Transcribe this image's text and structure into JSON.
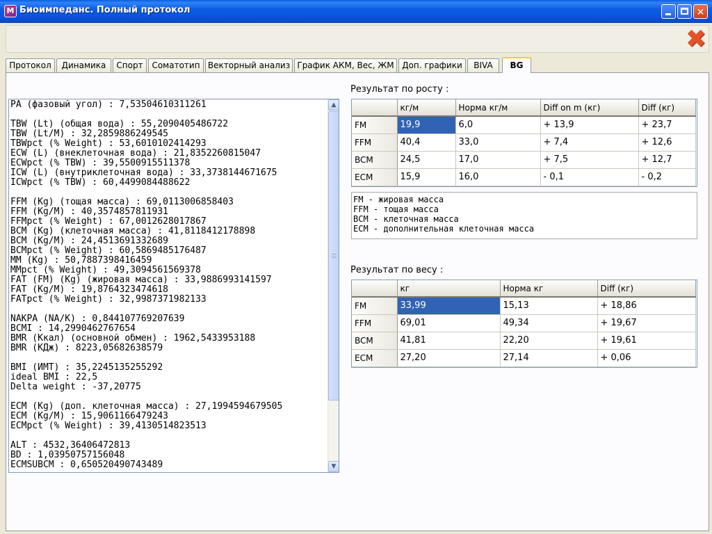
{
  "window": {
    "title": "Биоимпеданс.  Полный протокол",
    "icon": "app-logo-icon"
  },
  "tabs": [
    {
      "label": "Протокол",
      "active": false
    },
    {
      "label": "Динамика",
      "active": false
    },
    {
      "label": "Спорт",
      "active": false
    },
    {
      "label": "Соматотип",
      "active": false
    },
    {
      "label": "Векторный анализ",
      "active": false
    },
    {
      "label": "График АКМ, Вес, ЖМ",
      "active": false
    },
    {
      "label": "Доп. графики",
      "active": false
    },
    {
      "label": "BIVA",
      "active": false
    },
    {
      "label": "BG",
      "active": true
    }
  ],
  "protocol_lines": [
    "PA (фазовый угол) : 7,53504610311261",
    "",
    "TBW (Lt) (общая вода) : 55,2090405486722",
    "TBW (Lt/M) : 32,2859886249545",
    "TBWpct (% Weight) : 53,6010102414293",
    "ECW (L) (внеклеточная вода) : 21,8352260815047",
    "ECWpct (% TBW) : 39,5500915511378",
    "ICW (L) (внутриклеточная вода) : 33,3738144671675",
    "ICWpct (% TBW) : 60,4499084488622",
    "",
    "FFM (Kg) (тощая масса) : 69,0113006858403",
    "FFM (Kg/M) : 40,3574857811931",
    "FFMpct (% Weight) : 67,0012628017867",
    "BCM (Kg) (клеточная масса) : 41,8118412178898",
    "BCM (Kg/M) : 24,4513691332689",
    "BCMpct (% Weight) : 60,5869485176487",
    "MM (Kg) : 50,7887398416459",
    "MMpct (% Weight) : 49,3094561569378",
    "FAT (FM) (Kg) (жировая масса) : 33,9886993141597",
    "FAT (Kg/M) : 19,8764323474618",
    "FATpct (% Weight) : 32,9987371982133",
    "",
    "NAKPA (NA/K) : 0,844107769207639",
    "BCMI : 14,2990462767654",
    "BMR (Ккал) (основной обмен) : 1962,5433953188",
    "BMR (КДж) : 8223,05682638579",
    "",
    "BMI (ИМТ) : 35,2245135255292",
    "ideal BMI : 22,5",
    "Delta weight : -37,20775",
    "",
    "ECM (Kg) (доп. клеточная масса) : 27,1994594679505",
    "ECM (Kg/M) : 15,9061166479243",
    "ECMpct (% Weight) : 39,4130514823513",
    "",
    "ALT : 4532,36406472813",
    "BD : 1,03950757156048",
    "ECMSUBCM : 0,650520490743489"
  ],
  "height_table": {
    "title": "Результат по росту :",
    "columns": [
      "",
      "кг/м",
      "Норма кг/м",
      "Diff on m (кг)",
      "Diff (кг)"
    ],
    "rows": [
      [
        "FM",
        "19,9",
        "6,0",
        "+ 13,9",
        "+ 23,7"
      ],
      [
        "FFM",
        "40,4",
        "33,0",
        "+ 7,4",
        "+ 12,6"
      ],
      [
        "BCM",
        "24,5",
        "17,0",
        "+ 7,5",
        "+ 12,7"
      ],
      [
        "ECM",
        "15,9",
        "16,0",
        "- 0,1",
        "- 0,2"
      ]
    ]
  },
  "legend": [
    "FM - жировая масса",
    "FFM - тощая масса",
    "BCM - клеточная масса",
    "ECM - дополнительная клеточная масса"
  ],
  "weight_table": {
    "title": "Результат по весу :",
    "columns": [
      "",
      "кг",
      "Норма кг",
      "Diff (кг)"
    ],
    "rows": [
      [
        "FM",
        "33,99",
        "15,13",
        "+ 18,86"
      ],
      [
        "FFM",
        "69,01",
        "49,34",
        "+ 19,67"
      ],
      [
        "BCM",
        "41,81",
        "22,20",
        "+ 19,61"
      ],
      [
        "ECM",
        "27,20",
        "27,14",
        "+ 0,06"
      ]
    ]
  },
  "colors": {
    "selection": "#3163b4",
    "titlebar": "#0b55dc",
    "active_tab_accent": "#ffc83c"
  }
}
